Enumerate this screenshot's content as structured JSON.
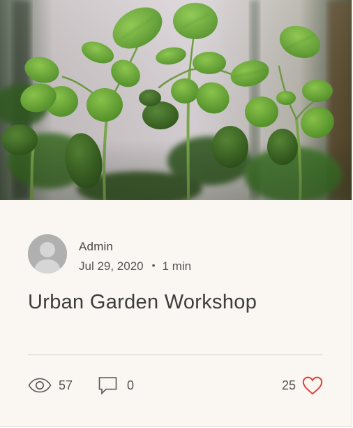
{
  "post": {
    "cover_image": "seedlings-photo",
    "author": {
      "avatar_icon": "user-silhouette-icon",
      "name": "Admin"
    },
    "date": "Jul 29, 2020",
    "separator": "•",
    "read_time": "1 min",
    "title": "Urban Garden Workshop"
  },
  "stats": {
    "views_icon": "eye-icon",
    "views_count": "57",
    "comments_icon": "comment-icon",
    "comments_count": "0",
    "likes_count": "25",
    "likes_icon": "heart-outline-icon"
  },
  "colors": {
    "card_background": "#faf7f2",
    "text": "#444444",
    "heart": "#e0403a",
    "leaf": "#5e9a2c"
  }
}
